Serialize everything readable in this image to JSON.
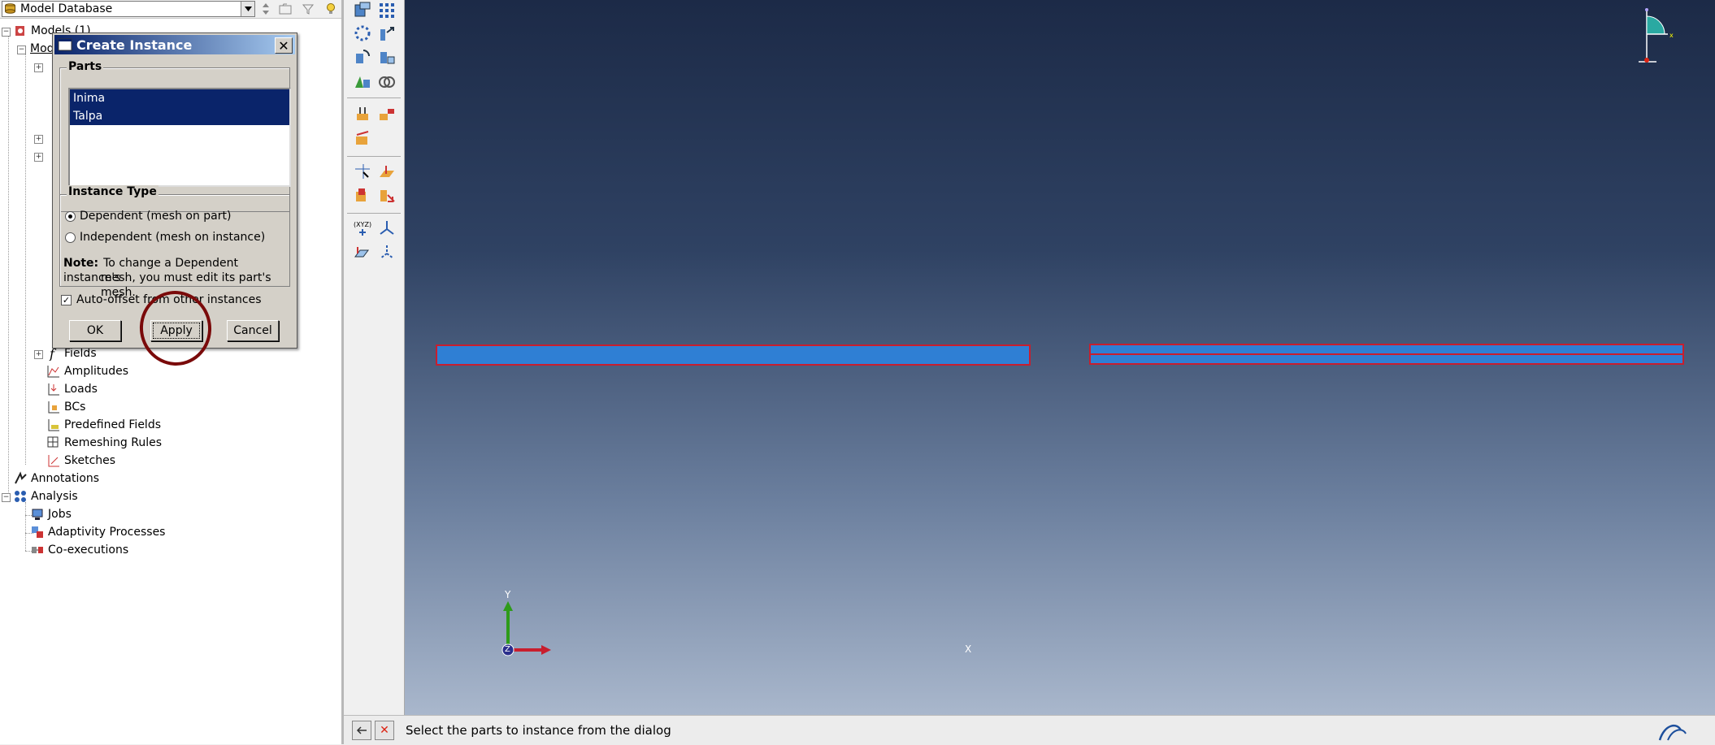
{
  "model_tree": {
    "database_label": "Model Database",
    "items": [
      {
        "label": "Models (1)"
      },
      {
        "label": "Mod"
      },
      {
        "label": "Fields"
      },
      {
        "label": "Amplitudes"
      },
      {
        "label": "Loads"
      },
      {
        "label": "BCs"
      },
      {
        "label": "Predefined Fields"
      },
      {
        "label": "Remeshing Rules"
      },
      {
        "label": "Sketches"
      },
      {
        "label": "Annotations"
      },
      {
        "label": "Analysis"
      },
      {
        "label": "Jobs"
      },
      {
        "label": "Adaptivity Processes"
      },
      {
        "label": "Co-executions"
      }
    ]
  },
  "dialog": {
    "title": "Create Instance",
    "parts_group": "Parts",
    "parts": [
      "Inima",
      "Talpa"
    ],
    "instance_type_group": "Instance Type",
    "option_dependent": "Dependent (mesh on part)",
    "option_independent": "Independent (mesh on instance)",
    "selected_option": "Dependent (mesh on part)",
    "note_label": "Note:",
    "note_line1": "To change a Dependent instance's",
    "note_line2": "mesh, you must edit its part's mesh.",
    "auto_offset_label": "Auto-offset from other instances",
    "auto_offset_checked": true,
    "ok_label": "OK",
    "apply_label": "Apply",
    "cancel_label": "Cancel"
  },
  "viewport": {
    "triad": {
      "x_label": "X",
      "y_label": "Y",
      "z_label": "Z"
    },
    "colors": {
      "part_fill": "#2f7fd4",
      "part_edge": "#c81e2e"
    }
  },
  "statusbar": {
    "prompt": "Select the parts to instance from the dialog"
  },
  "icons": [
    "database-icon",
    "cancel-x-icon",
    "back-arrow-icon",
    "simulia-logo"
  ]
}
